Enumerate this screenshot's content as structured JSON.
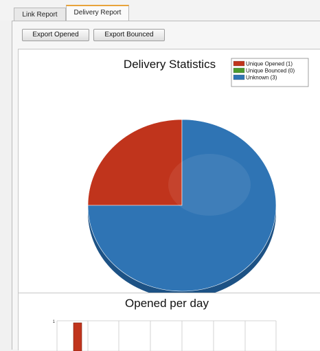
{
  "tabs": [
    {
      "label": "Link Report",
      "active": false
    },
    {
      "label": "Delivery Report",
      "active": true
    }
  ],
  "toolbar": {
    "export_opened_label": "Export Opened",
    "export_bounced_label": "Export Bounced"
  },
  "colors": {
    "accent_tab": "#e8a33a",
    "opened": "#c0341c",
    "bounced": "#4a9a2e",
    "unknown": "#2f74b4"
  },
  "chart_data": [
    {
      "type": "pie",
      "title": "Delivery Statistics",
      "categories": [
        "Unique Opened (1)",
        "Unique Bounced (0)",
        "Unknown (3)"
      ],
      "values": [
        1,
        0,
        3
      ],
      "legend_position": "top-right"
    },
    {
      "type": "bar",
      "title": "Opened per day",
      "values": [
        1
      ],
      "y_tick_labels": [
        "1"
      ]
    }
  ]
}
